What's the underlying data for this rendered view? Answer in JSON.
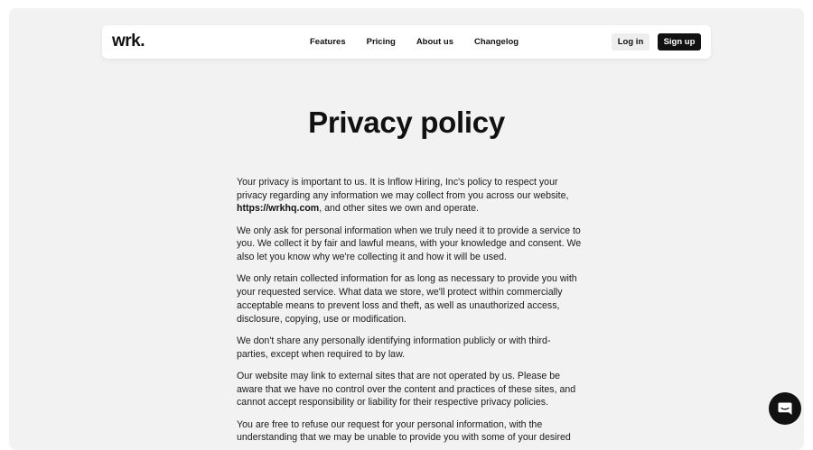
{
  "brand": {
    "logo": "wrk."
  },
  "nav": {
    "links": [
      "Features",
      "Pricing",
      "About us",
      "Changelog"
    ],
    "login_label": "Log in",
    "signup_label": "Sign up"
  },
  "page": {
    "title": "Privacy policy",
    "p1": {
      "before": "Your privacy is important to us. It is Inflow Hiring, Inc's policy to respect your privacy regarding any information we may collect from you across our website, ",
      "link": "https://wrkhq.com",
      "after": ", and other sites we own and operate."
    },
    "paragraphs": [
      "We only ask for personal information when we truly need it to provide a service to you. We collect it by fair and lawful means, with your knowledge and consent. We also let you know why we're collecting it and how it will be used.",
      "We only retain collected information for as long as necessary to provide you with your requested service. What data we store, we'll protect within commercially acceptable means to prevent loss and theft, as well as unauthorized access, disclosure, copying, use or modification.",
      "We don't share any personally identifying information publicly or with third-parties, except when required to by law.",
      "Our website may link to external sites that are not operated by us. Please be aware that we have no control over the content and practices of these sites, and cannot accept responsibility or liability for their respective privacy policies.",
      "You are free to refuse our request for your personal information, with the understanding that we may be unable to provide you with some of your desired"
    ]
  },
  "chat": {
    "icon": "chat-bubble-icon"
  },
  "colors": {
    "background": "#f2f2f2",
    "navbar": "#ffffff",
    "text": "#111111",
    "button_dark": "#111111",
    "button_light": "#eeeeee"
  }
}
